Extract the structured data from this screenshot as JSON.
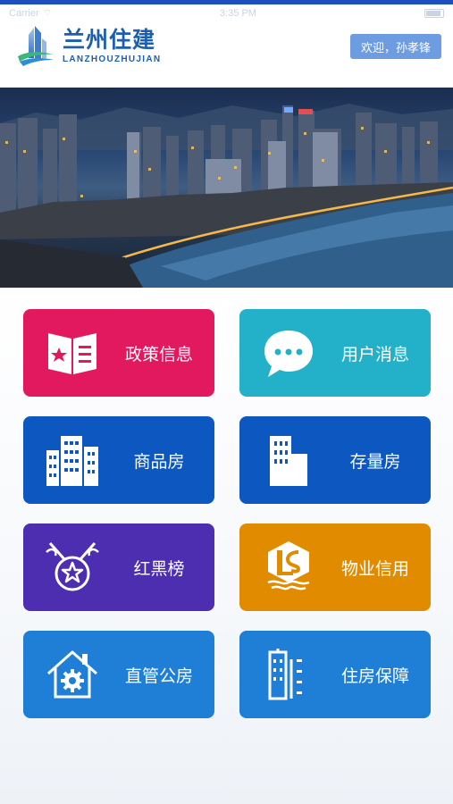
{
  "status_bar": {
    "carrier": "Carrier",
    "time": "3:35 PM"
  },
  "header": {
    "logo_cn": "兰州住建",
    "logo_en": "LANZHOUZHUJIAN",
    "welcome": "欢迎，孙孝锋"
  },
  "tiles": [
    {
      "label": "政策信息",
      "icon": "policy-book-icon",
      "color": "#e2195e"
    },
    {
      "label": "用户消息",
      "icon": "chat-bubble-icon",
      "color": "#22b1c9"
    },
    {
      "label": "商品房",
      "icon": "buildings-icon",
      "color": "#0d57c0"
    },
    {
      "label": "存量房",
      "icon": "building-icon",
      "color": "#0d57c0"
    },
    {
      "label": "红黑榜",
      "icon": "medal-star-icon",
      "color": "#4d2eb0"
    },
    {
      "label": "物业信用",
      "icon": "property-logo-icon",
      "color": "#e18c00"
    },
    {
      "label": "直管公房",
      "icon": "house-gear-icon",
      "color": "#1f7fd6"
    },
    {
      "label": "住房保障",
      "icon": "tower-blocks-icon",
      "color": "#1f7fd6"
    }
  ]
}
